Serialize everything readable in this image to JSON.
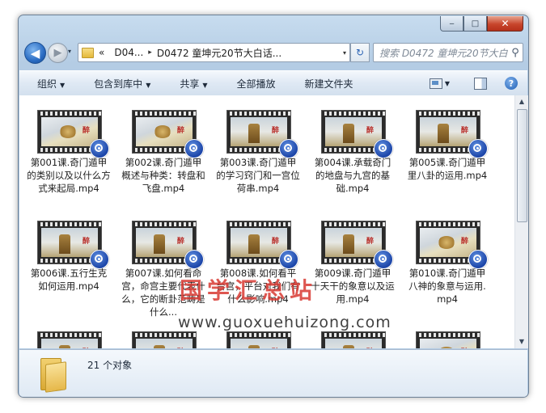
{
  "window": {
    "caption_min": "‒",
    "caption_max": "□",
    "caption_close": "✕"
  },
  "nav": {
    "back_glyph": "◀",
    "forward_glyph": "▶",
    "history_glyph": "▾",
    "address_prefix": "«",
    "breadcrumbs": [
      "D04...",
      "D0472 童坤元20节大白话..."
    ],
    "crumb_sep": "▸",
    "address_drop": "▾",
    "refresh_glyph": "↻",
    "search_placeholder": "搜索 D0472 童坤元20节大白..."
  },
  "toolbar": {
    "organize": "组织",
    "include_in_library": "包含到库中",
    "share": "共享",
    "play_all": "全部播放",
    "new_folder": "新建文件夹",
    "dropdown_glyph": "▼",
    "help_glyph": "?"
  },
  "files": [
    {
      "name": "第001课.奇门遁甲的类别以及以什么方式来起局.mp4",
      "thumb": "a"
    },
    {
      "name": "第002课.奇门遁甲概述与种类：转盘和飞盘.mp4",
      "thumb": "a"
    },
    {
      "name": "第003课.奇门遁甲的学习窍门和一宫位荷串.mp4",
      "thumb": "b"
    },
    {
      "name": "第004课.承载奇门的地盘与九宫的基础.mp4",
      "thumb": "b"
    },
    {
      "name": "第005课.奇门遁甲里八卦的运用.mp4",
      "thumb": "b"
    },
    {
      "name": "第006课.五行生克如何运用.mp4",
      "thumb": "b"
    },
    {
      "name": "第007课.如何看命宫，命宫主要代表什么，它的断卦范畴是什么...",
      "thumb": "b"
    },
    {
      "name": "第008课.如何看平台宫，平台对我们有什么影响.mp4",
      "thumb": "b"
    },
    {
      "name": "第009课.奇门遁甲十天干的象意以及运用.mp4",
      "thumb": "b"
    },
    {
      "name": "第010课.奇门遁甲八神的象意与运用.mp4",
      "thumb": "a"
    },
    {
      "name": "",
      "thumb": "b"
    },
    {
      "name": "",
      "thumb": "b"
    },
    {
      "name": "",
      "thumb": "b"
    },
    {
      "name": "",
      "thumb": "b"
    },
    {
      "name": "",
      "thumb": "a"
    }
  ],
  "watermark": {
    "title": "国学汇总站",
    "url": "www.guoxuehuizong.com"
  },
  "thumb_seal": "醉",
  "scroll": {
    "up": "▲",
    "down": "▼"
  },
  "details": {
    "item_count": "21 个对象"
  }
}
